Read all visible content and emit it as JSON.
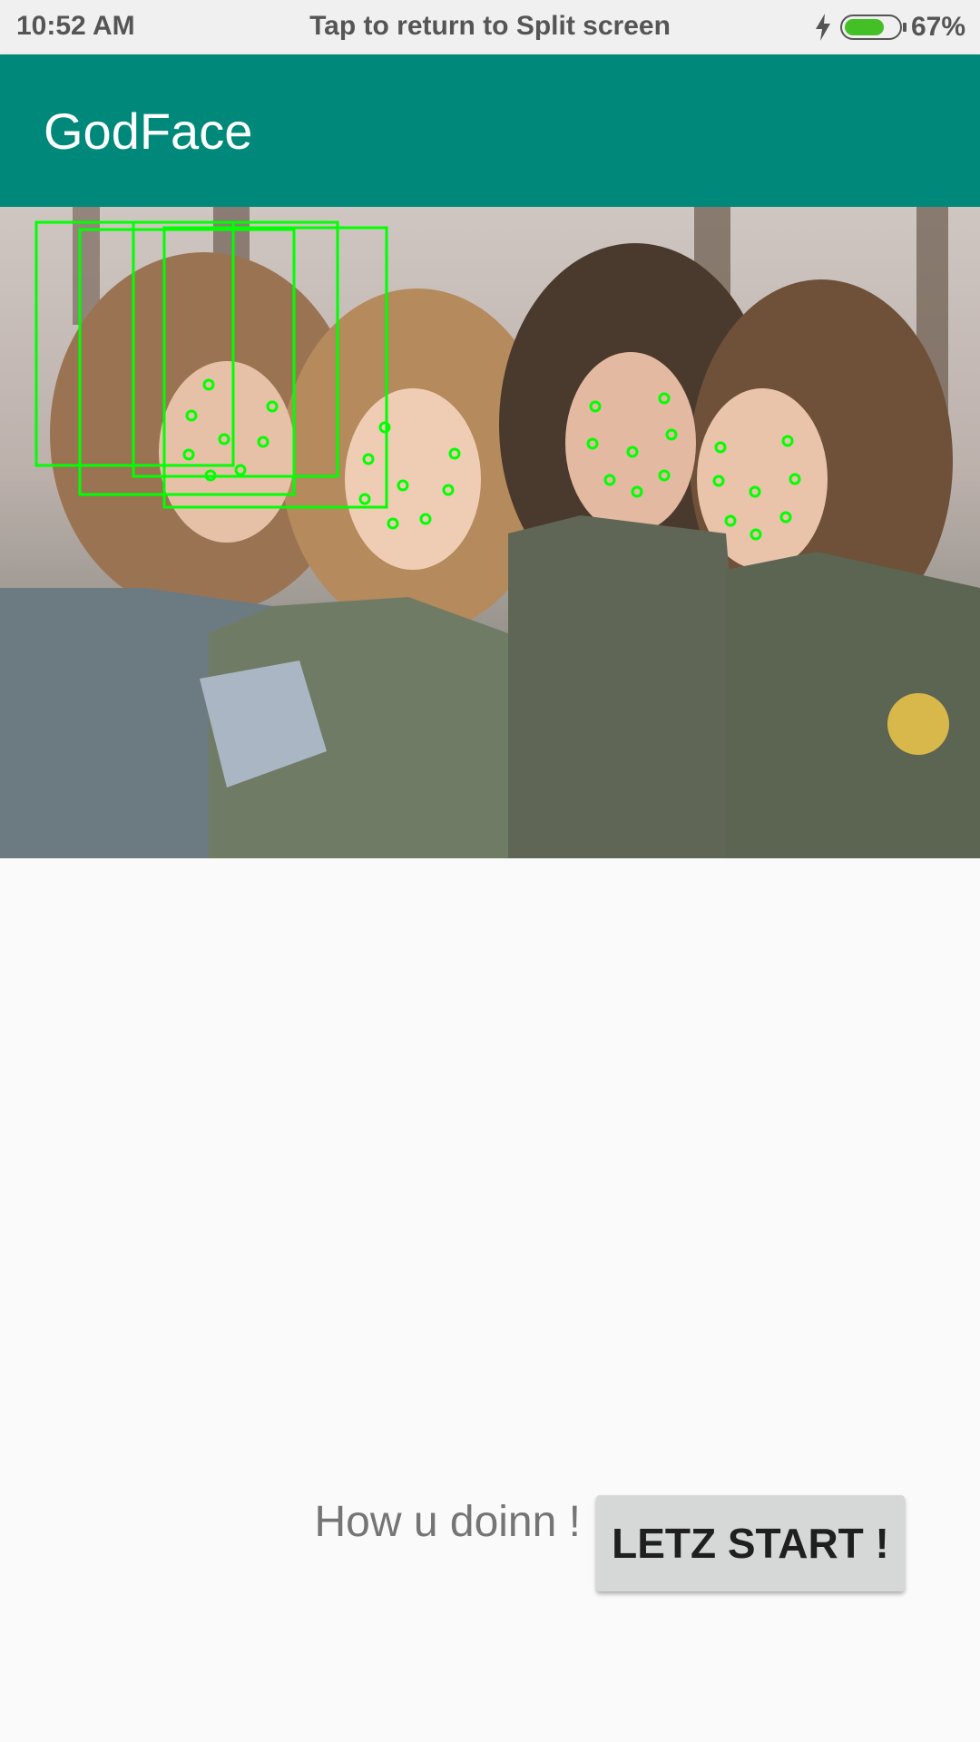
{
  "status_bar": {
    "time": "10:52 AM",
    "center_text": "Tap to return to Split screen",
    "battery_percent": "67%",
    "battery_level": 0.67,
    "icons": [
      "bolt-icon",
      "battery-icon"
    ],
    "battery_color": "#43c028"
  },
  "app_bar": {
    "title": "GodFace",
    "color": "#00897b"
  },
  "image": {
    "description_icon": "group-photo",
    "overlay_color": "#00ff00"
  },
  "greeting_text": "How u doinn !",
  "start_button_label": "LETZ START !"
}
